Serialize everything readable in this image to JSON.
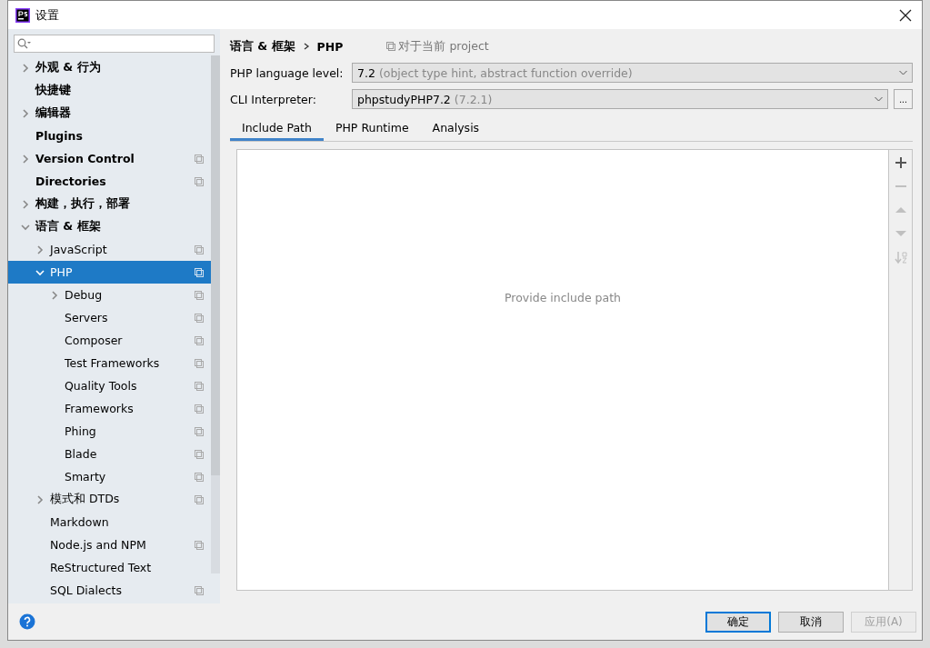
{
  "window": {
    "title": "设置"
  },
  "tree": [
    {
      "label": "外观 & 行为",
      "expanded": false,
      "project_scope": false,
      "selected": false
    },
    {
      "label": "快捷键",
      "project_scope": false,
      "selected": false
    },
    {
      "label": "编辑器",
      "expanded": false,
      "project_scope": false,
      "selected": false
    },
    {
      "label": "Plugins",
      "project_scope": false,
      "selected": false
    },
    {
      "label": "Version Control",
      "expanded": false,
      "project_scope": true,
      "selected": false
    },
    {
      "label": "Directories",
      "project_scope": true,
      "selected": false
    },
    {
      "label": "构建，执行，部署",
      "expanded": false,
      "project_scope": false,
      "selected": false
    },
    {
      "label": "语言 & 框架",
      "expanded": true,
      "project_scope": false,
      "selected": false,
      "children": [
        {
          "label": "JavaScript",
          "expanded": false,
          "project_scope": true,
          "selected": false
        },
        {
          "label": "PHP",
          "expanded": true,
          "project_scope": true,
          "selected": true,
          "children": [
            {
              "label": "Debug",
              "expanded": false,
              "project_scope": true,
              "selected": false
            },
            {
              "label": "Servers",
              "project_scope": true,
              "selected": false
            },
            {
              "label": "Composer",
              "project_scope": true,
              "selected": false
            },
            {
              "label": "Test Frameworks",
              "project_scope": true,
              "selected": false
            },
            {
              "label": "Quality Tools",
              "project_scope": true,
              "selected": false
            },
            {
              "label": "Frameworks",
              "project_scope": true,
              "selected": false
            },
            {
              "label": "Phing",
              "project_scope": true,
              "selected": false
            },
            {
              "label": "Blade",
              "project_scope": true,
              "selected": false
            },
            {
              "label": "Smarty",
              "project_scope": true,
              "selected": false
            }
          ]
        },
        {
          "label": "模式和 DTDs",
          "expanded": false,
          "project_scope": true,
          "selected": false
        },
        {
          "label": "Markdown",
          "project_scope": false,
          "selected": false
        },
        {
          "label": "Node.js and NPM",
          "project_scope": true,
          "selected": false
        },
        {
          "label": "ReStructured Text",
          "project_scope": false,
          "selected": false
        },
        {
          "label": "SQL Dialects",
          "project_scope": true,
          "selected": false
        }
      ]
    }
  ],
  "breadcrumb": [
    "语言 & 框架",
    "PHP"
  ],
  "scope_note": "对于当前 project",
  "fields": [
    {
      "label": "PHP language level:",
      "value": "7.2",
      "hint": "(object type hint, abstract function override)"
    },
    {
      "label": "CLI Interpreter:",
      "value": "phpstudyPHP7.2",
      "hint": "(7.2.1)",
      "browse_button": "..."
    }
  ],
  "tabs": [
    {
      "label": "Include Path",
      "selected": true
    },
    {
      "label": "PHP Runtime",
      "selected": false
    },
    {
      "label": "Analysis",
      "selected": false
    }
  ],
  "empty_text": "Provide include path",
  "toolbar": [
    {
      "kind": "add",
      "disabled": false
    },
    {
      "kind": "remove",
      "disabled": true
    },
    {
      "kind": "up",
      "disabled": true
    },
    {
      "kind": "down",
      "disabled": true
    },
    {
      "kind": "sort",
      "disabled": true
    }
  ],
  "buttons": [
    {
      "label": "确定",
      "default": true,
      "disabled": false
    },
    {
      "label": "取消",
      "default": false,
      "disabled": false
    },
    {
      "label": "应用(A)",
      "default": false,
      "disabled": true
    }
  ]
}
